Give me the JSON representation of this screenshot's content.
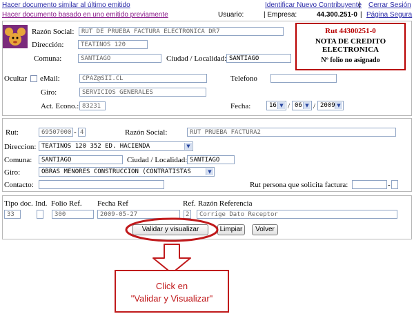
{
  "topbar": {
    "link_similar": "Hacer documento similar al último emitido",
    "link_based": "Hacer documento basado en uno emitido previamente",
    "usuario_label": "Usuario:",
    "link_new_contributor": "Identificar Nuevo Contribuyente",
    "sep1": "|",
    "link_logout": "Cerrar Sesión",
    "sep2": "|",
    "empresa_label": "| Empresa:",
    "empresa_value": "44.300.251-0",
    "sep3": "|",
    "link_secure": "Página Segura"
  },
  "issuer": {
    "razon_social_label": "Razón Social:",
    "razon_social_value": "RUT DE PRUEBA FACTURA ELECTRONICA DR7",
    "direccion_label": "Dirección:",
    "direccion_value": "TEATINOS 120",
    "comuna_label": "Comuna:",
    "comuna_value": "SANTIAGO",
    "ciudad_label": "Ciudad / Localidad:",
    "ciudad_value": "SANTIAGO",
    "ocultar_label": "Ocultar",
    "email_label": "eMail:",
    "email_value": "CPAZ@SII.CL",
    "telefono_label": "Telefono",
    "telefono_value": "",
    "giro_label": "Giro:",
    "giro_value": "SERVICIOS GENERALES",
    "acteco_label": "Act. Econo.:",
    "acteco_value": "83231",
    "fecha_label": "Fecha:",
    "fecha_day": "16",
    "fecha_month": "06",
    "fecha_year": "2009",
    "slash": "/"
  },
  "doc_box": {
    "rut": "Rut 44300251-0",
    "line1": "NOTA DE CREDITO",
    "line2": "ELECTRONICA",
    "folio": "Nº folio no asignado"
  },
  "receiver": {
    "rut_label": "Rut:",
    "rut_value": "69507000",
    "rut_dash": "-",
    "rut_dv": "4",
    "razon_social_label": "Razón Social:",
    "razon_social_value": "RUT PRUEBA FACTURA2",
    "direccion_label": "Direccion:",
    "direccion_value": "TEATINOS 120 352 ED. HACIENDA",
    "comuna_label": "Comuna:",
    "comuna_value": "SANTIAGO",
    "ciudad_label": "Ciudad / Localidad:",
    "ciudad_value": "SANTIAGO",
    "giro_label": "Giro:",
    "giro_value": "OBRAS MENORES CONSTRUCCION (CONTRATISTAS",
    "contacto_label": "Contacto:",
    "contacto_value": "",
    "solicita_label": "Rut persona que solicita factura:",
    "solicita_value": "",
    "solicita_dash": "-",
    "solicita_dv": ""
  },
  "reference": {
    "tipo_label": "Tipo doc.",
    "ind_label": "Ind.",
    "folio_label": "Folio Ref.",
    "fecha_label": "Fecha Ref",
    "ref_label": "Ref.",
    "razon_label": "Razón Referencia",
    "tipo_value": "33",
    "ind_value": "",
    "folio_value": "300",
    "fecha_value": "2009-05-27",
    "ref_value": "2",
    "razon_value": "Corrige Dato Receptor"
  },
  "buttons": {
    "validar": "Validar y visualizar",
    "limpiar": "Limpiar",
    "volver": "Volver"
  },
  "annotation": {
    "line1": "Click en",
    "line2": "\"Validar y Visualizar\""
  },
  "colors": {
    "link": "#2a2aa8",
    "accent_red": "#c0191b",
    "input_border": "#8fa4c4"
  }
}
